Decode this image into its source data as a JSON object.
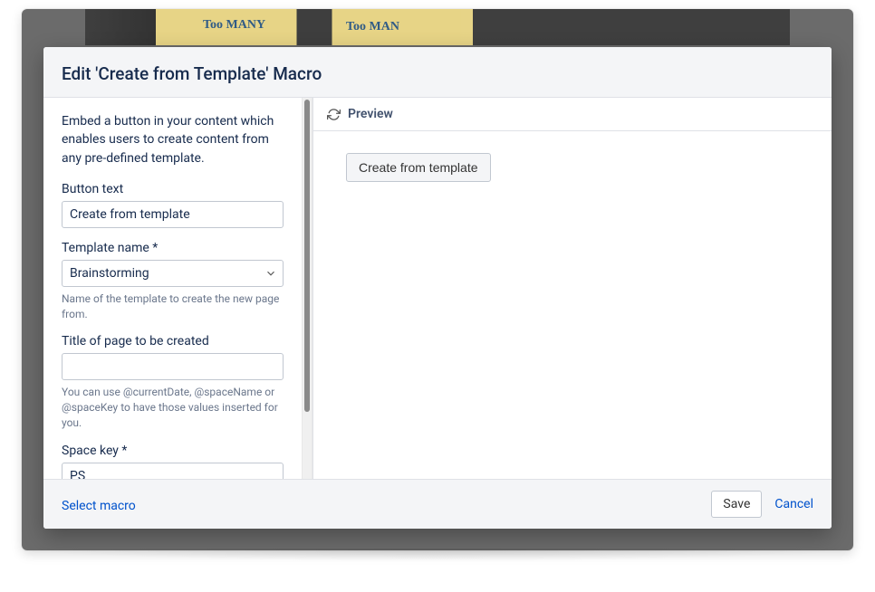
{
  "dialog": {
    "title": "Edit 'Create from Template' Macro"
  },
  "form": {
    "description": "Embed a button in your content which enables users to create content from any pre-defined template.",
    "button_text": {
      "label": "Button text",
      "value": "Create from template"
    },
    "template_name": {
      "label": "Template name *",
      "value": "Brainstorming",
      "hint": "Name of the template to create the new page from."
    },
    "page_title": {
      "label": "Title of page to be created",
      "value": "",
      "hint": "You can use @currentDate, @spaceName or @spaceKey to have those values inserted for you."
    },
    "space_key": {
      "label": "Space key *",
      "value": "PS"
    }
  },
  "preview": {
    "header": "Preview",
    "button_label": "Create from template"
  },
  "footer": {
    "select_macro": "Select macro",
    "save": "Save",
    "cancel": "Cancel"
  },
  "backdrop_notes": {
    "note1": "Too MANY",
    "note2": "Too MAN"
  }
}
